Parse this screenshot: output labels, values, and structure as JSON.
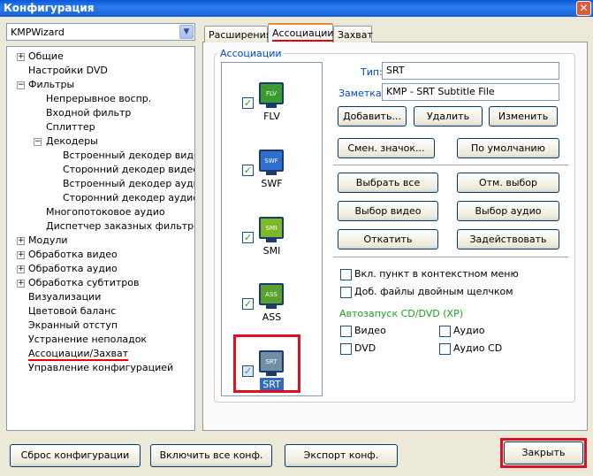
{
  "window": {
    "title": "Конфигурация",
    "close_label": "✕"
  },
  "profile_combo": {
    "value": "KMPWizard"
  },
  "tree": {
    "items": [
      {
        "label": "Общие"
      },
      {
        "label": "Настройки DVD"
      },
      {
        "label": "Фильтры"
      },
      {
        "label": "Непрерывное воспр."
      },
      {
        "label": "Входной фильтр"
      },
      {
        "label": "Сплиттер"
      },
      {
        "label": "Декодеры"
      },
      {
        "label": "Встроенный декодер видео"
      },
      {
        "label": "Сторонний декодер видео"
      },
      {
        "label": "Встроенный декодер аудио"
      },
      {
        "label": "Сторонний декодер аудио"
      },
      {
        "label": "Многопотоковое аудио"
      },
      {
        "label": "Диспетчер заказных фильтров"
      },
      {
        "label": "Модули"
      },
      {
        "label": "Обработка видео"
      },
      {
        "label": "Обработка аудио"
      },
      {
        "label": "Обработка субтитров"
      },
      {
        "label": "Визуализации"
      },
      {
        "label": "Цветовой баланс"
      },
      {
        "label": "Экранный отступ"
      },
      {
        "label": "Устранение неполадок"
      },
      {
        "label": "Ассоциации/Захват"
      },
      {
        "label": "Управление конфигурацией"
      }
    ]
  },
  "tabs": [
    "Расширения",
    "Ассоциации",
    "Захват"
  ],
  "group_title": "Ассоциации",
  "formats": [
    {
      "label": "FLV",
      "icon": "FLV",
      "checked": true,
      "color": "#3a9b2e"
    },
    {
      "label": "SWF",
      "icon": "SWF",
      "checked": true,
      "color": "#2f6fd0"
    },
    {
      "label": "SMI",
      "icon": "SMI",
      "checked": true,
      "color": "#7cb82a"
    },
    {
      "label": "ASS",
      "icon": "ASS",
      "checked": true,
      "color": "#5aa02c"
    },
    {
      "label": "SRT",
      "icon": "SRT",
      "checked": true,
      "color": "#6f8fa3"
    }
  ],
  "type_field": {
    "label": "Тип:",
    "value": "SRT"
  },
  "note_field": {
    "label": "Заметка:",
    "value": "KMP - SRT Subtitle File"
  },
  "buttons": {
    "add": "Добавить...",
    "remove": "Удалить",
    "edit": "Изменить",
    "change_icon": "Смен. значок...",
    "default": "По умолчанию",
    "select_all": "Выбрать все",
    "deselect": "Отм. выбор",
    "select_video": "Выбор видео",
    "select_audio": "Выбор аудио",
    "rollback": "Откатить",
    "apply": "Задействовать"
  },
  "checkboxes": {
    "context_menu": "Вкл. пункт в контекстном меню",
    "double_click": "Доб. файлы двойным щелчком"
  },
  "autorun": {
    "title": "Автозапуск CD/DVD (XP)",
    "video": "Видео",
    "audio": "Аудио",
    "dvd": "DVD",
    "audio_cd": "Аудио CD"
  },
  "bottom": {
    "reset": "Сброс конфигурации",
    "enable_all": "Включить все конф.",
    "export": "Экспорт конф.",
    "close": "Закрыть"
  }
}
